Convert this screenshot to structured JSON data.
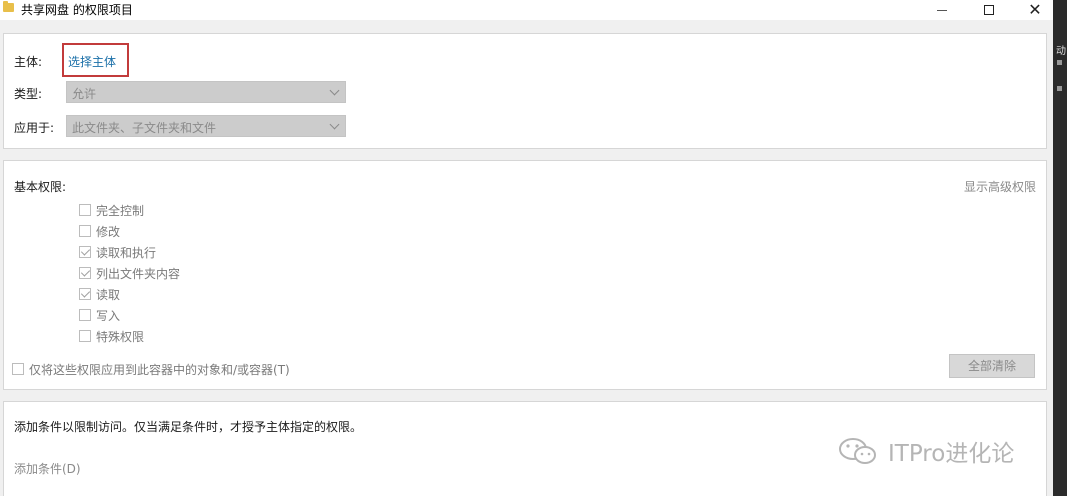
{
  "window": {
    "title": "共享网盘 的权限项目",
    "minimize_symbol": "",
    "maximize_symbol": "",
    "close_symbol": "✕"
  },
  "principal": {
    "label": "主体:",
    "link_text": "选择主体"
  },
  "type_field": {
    "label": "类型:",
    "value": "允许"
  },
  "applies_to": {
    "label": "应用于:",
    "value": "此文件夹、子文件夹和文件"
  },
  "basic_permissions": {
    "heading": "基本权限:",
    "show_advanced": "显示高级权限",
    "items": [
      {
        "label": "完全控制",
        "checked": false
      },
      {
        "label": "修改",
        "checked": false
      },
      {
        "label": "读取和执行",
        "checked": true
      },
      {
        "label": "列出文件夹内容",
        "checked": true
      },
      {
        "label": "读取",
        "checked": true
      },
      {
        "label": "写入",
        "checked": false
      },
      {
        "label": "特殊权限",
        "checked": false
      }
    ],
    "apply_only_label": "仅将这些权限应用到此容器中的对象和/或容器(T)",
    "apply_only_checked": false,
    "clear_all_button": "全部清除"
  },
  "conditions": {
    "description": "添加条件以限制访问。仅当满足条件时，才授予主体指定的权限。",
    "add_condition": "添加条件(D)"
  },
  "side_strip": {
    "char": "动"
  },
  "watermark": {
    "text": "ITPro进化论"
  },
  "colors": {
    "link": "#1a6fa8",
    "highlight_box": "#c23b3b",
    "disabled_text": "#8a8a8a"
  }
}
